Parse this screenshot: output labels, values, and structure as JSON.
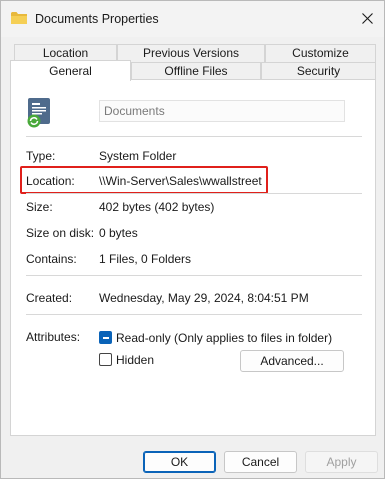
{
  "window": {
    "title": "Documents Properties",
    "close_label": "✕"
  },
  "tabs": {
    "row1": [
      "Location",
      "Previous Versions",
      "Customize"
    ],
    "row2": [
      "General",
      "Offline Files",
      "Security"
    ],
    "active": "General"
  },
  "general": {
    "name_value": "Documents",
    "type_label": "Type:",
    "type_value": "System Folder",
    "location_label": "Location:",
    "location_value": "\\\\Win-Server\\Sales\\wwallstreet",
    "size_label": "Size:",
    "size_value": "402 bytes (402 bytes)",
    "size_on_disk_label": "Size on disk:",
    "size_on_disk_value": "0 bytes",
    "contains_label": "Contains:",
    "contains_value": "1 Files, 0 Folders",
    "created_label": "Created:",
    "created_value": "Wednesday, May 29, 2024, 8:04:51 PM",
    "attributes_label": "Attributes:",
    "readonly_label": "Read-only (Only applies to files in folder)",
    "readonly_state": "indeterminate",
    "hidden_label": "Hidden",
    "hidden_checked": false,
    "advanced_label": "Advanced..."
  },
  "footer": {
    "ok_label": "OK",
    "cancel_label": "Cancel",
    "apply_label": "Apply"
  },
  "colors": {
    "accent": "#0a63b8",
    "highlight_border": "#e0201b"
  }
}
